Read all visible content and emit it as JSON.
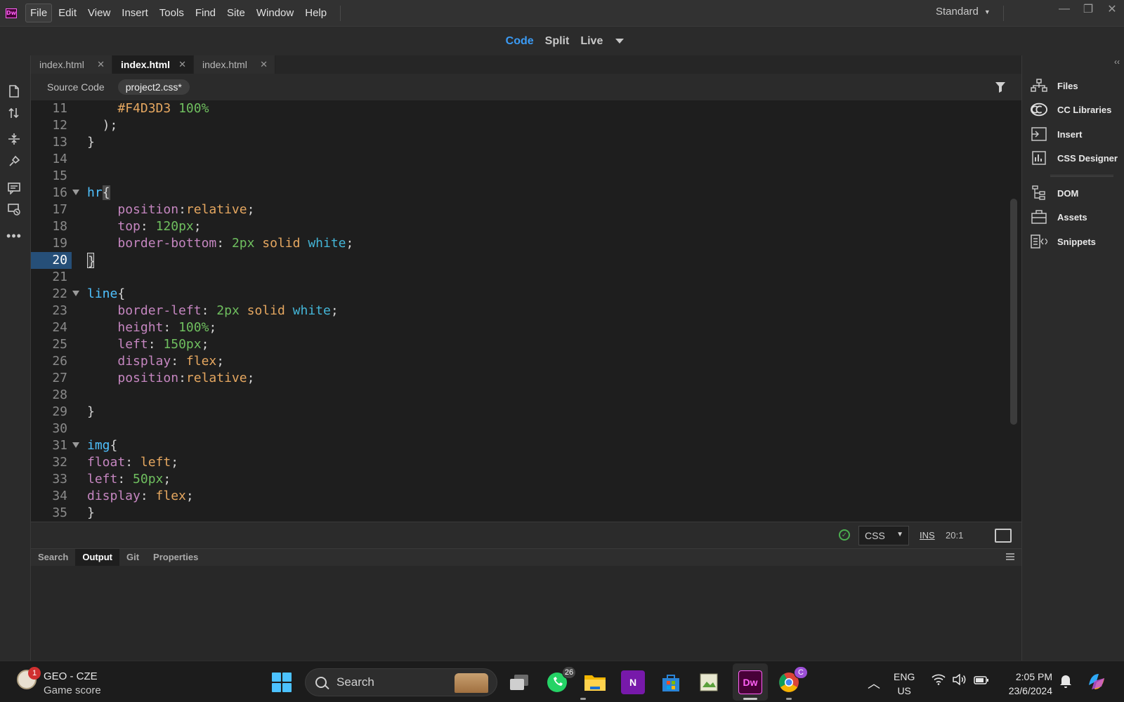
{
  "app": {
    "logo": "Dw",
    "menu": [
      "File",
      "Edit",
      "View",
      "Insert",
      "Tools",
      "Find",
      "Site",
      "Window",
      "Help"
    ],
    "active_menu": "File",
    "workspace": "Standard"
  },
  "view_modes": {
    "code": "Code",
    "split": "Split",
    "live": "Live",
    "active": "Code"
  },
  "document_tabs": [
    {
      "label": "index.html",
      "active": false
    },
    {
      "label": "index.html",
      "active": true
    },
    {
      "label": "index.html",
      "active": false
    }
  ],
  "related_files": {
    "source": "Source Code",
    "active_file": "project2.css*"
  },
  "code_lines": [
    {
      "n": "11",
      "tokens": [
        {
          "t": "    ",
          "c": "pun"
        },
        {
          "t": "#F4D3D3",
          "c": "val"
        },
        {
          "t": " ",
          "c": "pun"
        },
        {
          "t": "100%",
          "c": "num"
        }
      ]
    },
    {
      "n": "12",
      "tokens": [
        {
          "t": "  );",
          "c": "pun"
        }
      ]
    },
    {
      "n": "13",
      "tokens": [
        {
          "t": "}",
          "c": "pun"
        }
      ]
    },
    {
      "n": "14",
      "tokens": []
    },
    {
      "n": "15",
      "tokens": []
    },
    {
      "n": "16",
      "fold": true,
      "tokens": [
        {
          "t": "hr",
          "c": "sel"
        },
        {
          "t": "{",
          "c": "hl"
        }
      ]
    },
    {
      "n": "17",
      "tokens": [
        {
          "t": "    ",
          "c": "pun"
        },
        {
          "t": "position",
          "c": "prop"
        },
        {
          "t": ":",
          "c": "pun"
        },
        {
          "t": "relative",
          "c": "val"
        },
        {
          "t": ";",
          "c": "pun"
        }
      ]
    },
    {
      "n": "18",
      "tokens": [
        {
          "t": "    ",
          "c": "pun"
        },
        {
          "t": "top",
          "c": "prop"
        },
        {
          "t": ": ",
          "c": "pun"
        },
        {
          "t": "120px",
          "c": "num"
        },
        {
          "t": ";",
          "c": "pun"
        }
      ]
    },
    {
      "n": "19",
      "tokens": [
        {
          "t": "    ",
          "c": "pun"
        },
        {
          "t": "border-bottom",
          "c": "prop"
        },
        {
          "t": ": ",
          "c": "pun"
        },
        {
          "t": "2px",
          "c": "num"
        },
        {
          "t": " ",
          "c": "pun"
        },
        {
          "t": "solid",
          "c": "val"
        },
        {
          "t": " ",
          "c": "pun"
        },
        {
          "t": "white",
          "c": "kw"
        },
        {
          "t": ";",
          "c": "pun"
        }
      ]
    },
    {
      "n": "20",
      "current": true,
      "tokens": [
        {
          "t": "}",
          "c": "cursor"
        }
      ]
    },
    {
      "n": "21",
      "tokens": []
    },
    {
      "n": "22",
      "fold": true,
      "tokens": [
        {
          "t": "line",
          "c": "sel"
        },
        {
          "t": "{",
          "c": "pun"
        }
      ]
    },
    {
      "n": "23",
      "tokens": [
        {
          "t": "    ",
          "c": "pun"
        },
        {
          "t": "border-left",
          "c": "prop"
        },
        {
          "t": ": ",
          "c": "pun"
        },
        {
          "t": "2px",
          "c": "num"
        },
        {
          "t": " ",
          "c": "pun"
        },
        {
          "t": "solid",
          "c": "val"
        },
        {
          "t": " ",
          "c": "pun"
        },
        {
          "t": "white",
          "c": "kw"
        },
        {
          "t": ";",
          "c": "pun"
        }
      ]
    },
    {
      "n": "24",
      "tokens": [
        {
          "t": "    ",
          "c": "pun"
        },
        {
          "t": "height",
          "c": "prop"
        },
        {
          "t": ": ",
          "c": "pun"
        },
        {
          "t": "100%",
          "c": "num"
        },
        {
          "t": ";",
          "c": "pun"
        }
      ]
    },
    {
      "n": "25",
      "tokens": [
        {
          "t": "    ",
          "c": "pun"
        },
        {
          "t": "left",
          "c": "prop"
        },
        {
          "t": ": ",
          "c": "pun"
        },
        {
          "t": "150px",
          "c": "num"
        },
        {
          "t": ";",
          "c": "pun"
        }
      ]
    },
    {
      "n": "26",
      "tokens": [
        {
          "t": "    ",
          "c": "pun"
        },
        {
          "t": "display",
          "c": "prop"
        },
        {
          "t": ": ",
          "c": "pun"
        },
        {
          "t": "flex",
          "c": "val"
        },
        {
          "t": ";",
          "c": "pun"
        }
      ]
    },
    {
      "n": "27",
      "tokens": [
        {
          "t": "    ",
          "c": "pun"
        },
        {
          "t": "position",
          "c": "prop"
        },
        {
          "t": ":",
          "c": "pun"
        },
        {
          "t": "relative",
          "c": "val"
        },
        {
          "t": ";",
          "c": "pun"
        }
      ]
    },
    {
      "n": "28",
      "tokens": []
    },
    {
      "n": "29",
      "tokens": [
        {
          "t": "}",
          "c": "pun"
        }
      ]
    },
    {
      "n": "30",
      "tokens": []
    },
    {
      "n": "31",
      "fold": true,
      "tokens": [
        {
          "t": "img",
          "c": "sel"
        },
        {
          "t": "{",
          "c": "pun"
        }
      ]
    },
    {
      "n": "32",
      "tokens": [
        {
          "t": "float",
          "c": "prop"
        },
        {
          "t": ": ",
          "c": "pun"
        },
        {
          "t": "left",
          "c": "val"
        },
        {
          "t": ";",
          "c": "pun"
        }
      ]
    },
    {
      "n": "33",
      "tokens": [
        {
          "t": "left",
          "c": "prop"
        },
        {
          "t": ": ",
          "c": "pun"
        },
        {
          "t": "50px",
          "c": "num"
        },
        {
          "t": ";",
          "c": "pun"
        }
      ]
    },
    {
      "n": "34",
      "tokens": [
        {
          "t": "display",
          "c": "prop"
        },
        {
          "t": ": ",
          "c": "pun"
        },
        {
          "t": "flex",
          "c": "val"
        },
        {
          "t": ";",
          "c": "pun"
        }
      ]
    },
    {
      "n": "35",
      "tokens": [
        {
          "t": "}",
          "c": "pun"
        }
      ]
    }
  ],
  "status": {
    "language": "CSS",
    "mode": "INS",
    "position": "20:1"
  },
  "bottom_tabs": [
    {
      "label": "Search",
      "active": false
    },
    {
      "label": "Output",
      "active": true
    },
    {
      "label": "Git",
      "active": false
    },
    {
      "label": "Properties",
      "active": false
    }
  ],
  "right_panels": [
    {
      "label": "Files",
      "icon": "files-icon"
    },
    {
      "label": "CC Libraries",
      "icon": "cc-libraries-icon"
    },
    {
      "label": "Insert",
      "icon": "insert-icon"
    },
    {
      "label": "CSS Designer",
      "icon": "css-designer-icon"
    },
    {
      "label": "DOM",
      "icon": "dom-icon"
    },
    {
      "label": "Assets",
      "icon": "assets-icon"
    },
    {
      "label": "Snippets",
      "icon": "snippets-icon"
    }
  ],
  "taskbar": {
    "widget_title": "GEO - CZE",
    "widget_subtitle": "Game score",
    "widget_badge": "1",
    "search_label": "Search",
    "whatsapp_badge": "26",
    "chrome_badge": "C",
    "dw_label": "Dw",
    "onenote_label": "N",
    "lang_line1": "ENG",
    "lang_line2": "US",
    "time": "2:05 PM",
    "date": "23/6/2024"
  },
  "colors": {
    "accent": "#3b9bf5",
    "selector": "#4fc1ff",
    "property": "#c586c0",
    "value": "#e5a760",
    "number": "#6fbf5f",
    "keyword": "#44b6d8"
  }
}
